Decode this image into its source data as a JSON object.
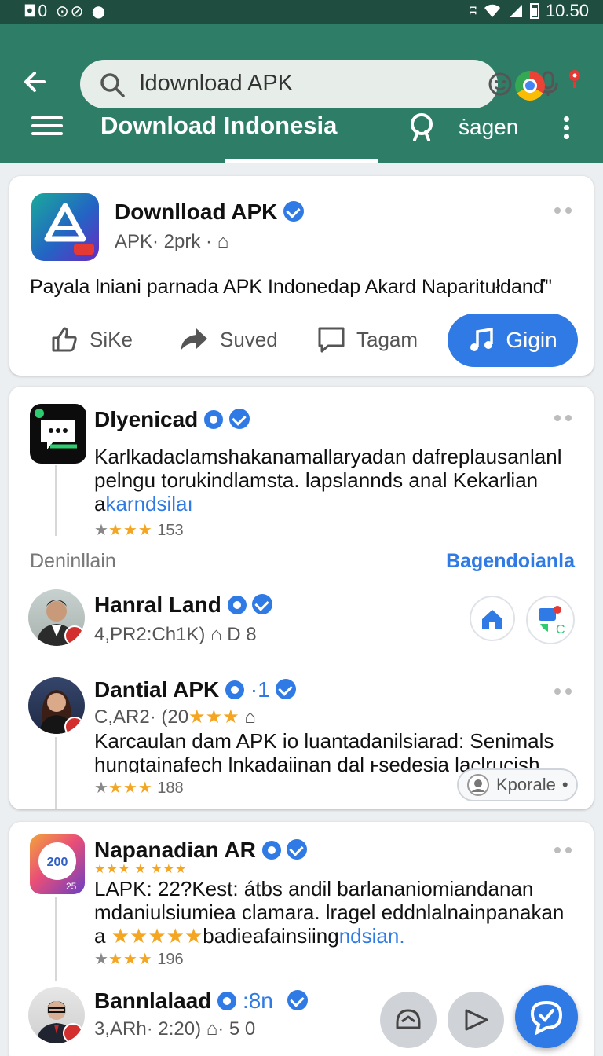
{
  "status": {
    "left_icons": "◘0 ⊙⊘ ●",
    "time": "10.50"
  },
  "toolbar": {
    "search_value": "ldownload APK",
    "title": "Download Indonesia",
    "action_label": "ṡagen"
  },
  "post": {
    "name": "Downlload APK",
    "meta": "APK· 2prk  ·",
    "body": "Payala lniani parnada APK Indonedap Akard Naparitułdanď\"",
    "actions": {
      "like": "SiKe",
      "saved": "Suved",
      "tag": "Tagam",
      "primary": "Gigin"
    }
  },
  "feed": {
    "item1": {
      "name": "Dlyenicad",
      "body": "Karlkadaclamshakanamallaryadan dafreplausanlanl pelngu torukindlamsta. lapslannds anal Kekarlian a",
      "body_link": "karndsilaı",
      "stars": "★★★",
      "rating": "153"
    },
    "section_label": "Deninllain",
    "section_link": "Bagendoianla",
    "item2": {
      "name": "Hanral Land",
      "meta": "4,PR2:Ch1K)",
      "meta2": "D 8"
    },
    "item3": {
      "name": "Dantial APK",
      "badge_text": "·1",
      "meta": "C,AR2· (20",
      "stars": "★★★",
      "body": "Karcaulan dam APK io luantadanilsiarad: Senimals hungtainafech lnkadaiinan dal ⱶsedesia laclrucish",
      "rating_stars": "★★★",
      "rating": "188",
      "chip": "Kporale"
    }
  },
  "feed2": {
    "item1": {
      "name": "Napanadian AR",
      "stars_top": "★★★  ★  ★★★",
      "body_line1": "LAPK: 22?Kest: átbs andil barlananiomiandanan mdaniulsiumiea clamara. lragel eddnlalnainpanakan",
      "body_prefix": "a",
      "body_stars": "★★★★★",
      "body_tail": "badieafainsiing",
      "body_link": "ndsian.",
      "rating_stars": "★★★",
      "rating": "196"
    },
    "item2": {
      "name": "Bannlalaad",
      "badge_text": ":8n",
      "meta": "3,ARh· 2:20)",
      "meta2": "· 5 0"
    }
  },
  "colors": {
    "appbar": "#2e7d67",
    "statusbar": "#1f4d3f",
    "accent": "#2f7ae5",
    "star": "#f4a521"
  },
  "icons": [
    "back-arrow-icon",
    "search-icon",
    "emoji-icon",
    "mic-icon",
    "chrome-icon",
    "pin-icon",
    "menu-icon",
    "more-vert-icon",
    "thumbs-up-icon",
    "share-icon",
    "comment-icon",
    "music-note-icon",
    "verified-icon",
    "home-icon",
    "chat-icon",
    "profile-icon",
    "send-icon",
    "check-icon"
  ]
}
